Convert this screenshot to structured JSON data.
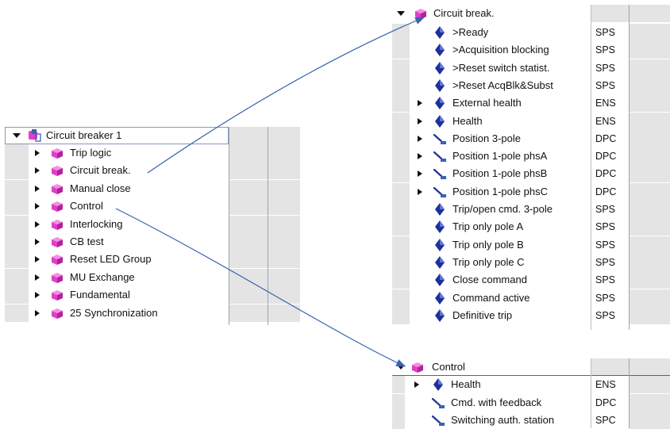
{
  "panel_left": {
    "root": {
      "label": "Circuit breaker 1",
      "icon": "function-group-icon"
    },
    "items": [
      {
        "label": "Trip logic",
        "icon": "function-block-icon"
      },
      {
        "label": "Circuit break.",
        "icon": "function-block-icon"
      },
      {
        "label": "Manual close",
        "icon": "function-block-icon"
      },
      {
        "label": "Control",
        "icon": "function-block-icon"
      },
      {
        "label": "Interlocking",
        "icon": "function-block-icon"
      },
      {
        "label": "CB test",
        "icon": "function-block-icon"
      },
      {
        "label": "Reset LED Group",
        "icon": "function-block-icon"
      },
      {
        "label": "MU Exchange",
        "icon": "function-block-icon"
      },
      {
        "label": "Fundamental",
        "icon": "function-block-icon"
      },
      {
        "label": "25 Synchronization",
        "icon": "function-block-icon"
      }
    ]
  },
  "panel_circuit_break": {
    "title": "Circuit break.",
    "rows": [
      {
        "label": ">Ready",
        "type": "SPS",
        "icon": "diamond",
        "expandable": false
      },
      {
        "label": ">Acquisition blocking",
        "type": "SPS",
        "icon": "diamond",
        "expandable": false
      },
      {
        "label": ">Reset switch statist.",
        "type": "SPS",
        "icon": "diamond",
        "expandable": false
      },
      {
        "label": ">Reset AcqBlk&Subst",
        "type": "SPS",
        "icon": "diamond",
        "expandable": false
      },
      {
        "label": "External health",
        "type": "ENS",
        "icon": "diamond",
        "expandable": true
      },
      {
        "label": "Health",
        "type": "ENS",
        "icon": "diamond",
        "expandable": true
      },
      {
        "label": "Position 3-pole",
        "type": "DPC",
        "icon": "switch",
        "expandable": true
      },
      {
        "label": "Position 1-pole phsA",
        "type": "DPC",
        "icon": "switch",
        "expandable": true
      },
      {
        "label": "Position 1-pole phsB",
        "type": "DPC",
        "icon": "switch",
        "expandable": true
      },
      {
        "label": "Position 1-pole phsC",
        "type": "DPC",
        "icon": "switch",
        "expandable": true
      },
      {
        "label": "Trip/open cmd. 3-pole",
        "type": "SPS",
        "icon": "diamond",
        "expandable": false
      },
      {
        "label": "Trip only pole A",
        "type": "SPS",
        "icon": "diamond",
        "expandable": false
      },
      {
        "label": "Trip only pole B",
        "type": "SPS",
        "icon": "diamond",
        "expandable": false
      },
      {
        "label": "Trip only pole C",
        "type": "SPS",
        "icon": "diamond",
        "expandable": false
      },
      {
        "label": "Close command",
        "type": "SPS",
        "icon": "diamond",
        "expandable": false
      },
      {
        "label": "Command active",
        "type": "SPS",
        "icon": "diamond",
        "expandable": false
      },
      {
        "label": "Definitive trip",
        "type": "SPS",
        "icon": "diamond",
        "expandable": false
      }
    ]
  },
  "panel_control": {
    "title": "Control",
    "rows": [
      {
        "label": "Health",
        "type": "ENS",
        "icon": "diamond",
        "expandable": true
      },
      {
        "label": "Cmd. with feedback",
        "type": "DPC",
        "icon": "switch",
        "expandable": false
      },
      {
        "label": "Switching auth. station",
        "type": "SPC",
        "icon": "switch",
        "expandable": false
      }
    ]
  },
  "colors": {
    "diamond": "#1f2f9a",
    "block_pink": "#e040c8",
    "arrow": "#3a62b0",
    "grid_grey": "#e4e4e4"
  }
}
